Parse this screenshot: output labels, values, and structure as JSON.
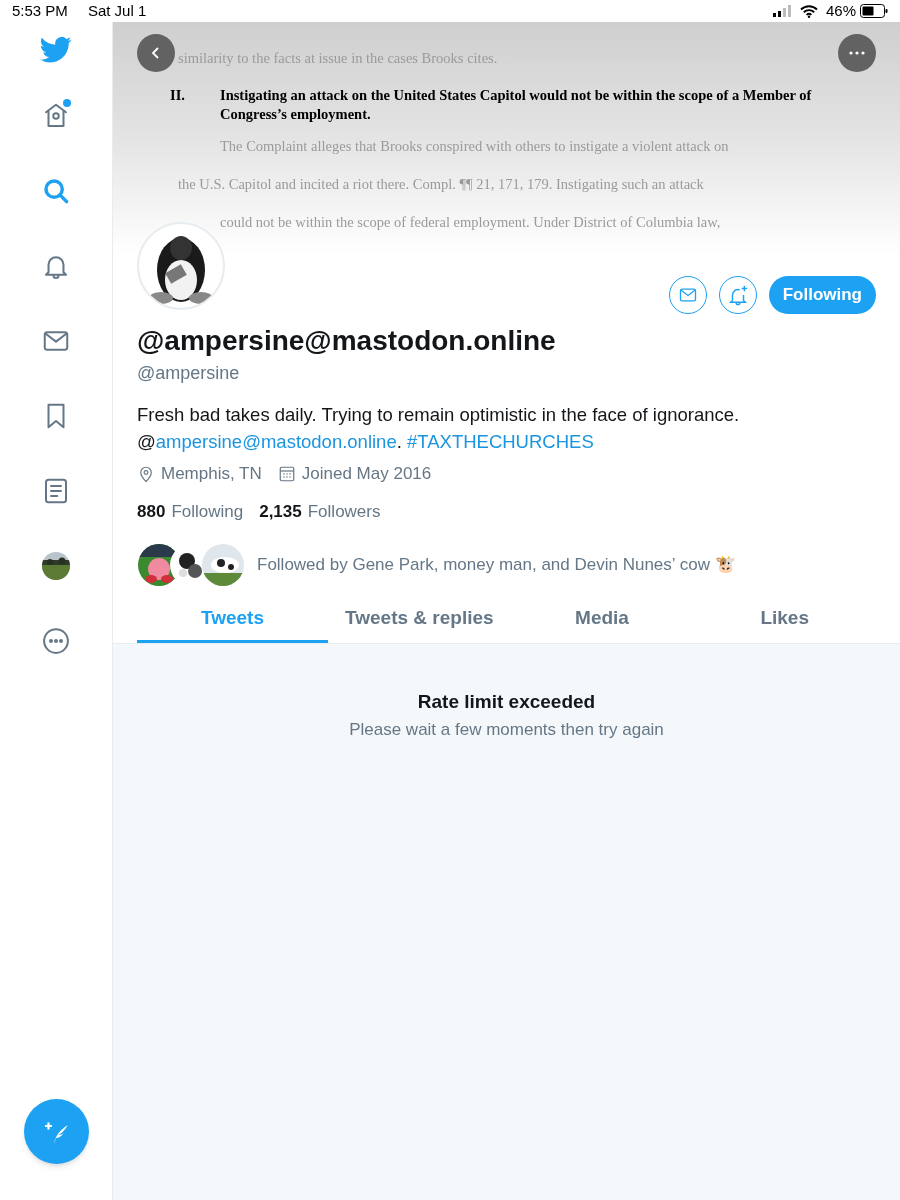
{
  "status_bar": {
    "time": "5:53 PM",
    "date": "Sat Jul 1",
    "battery": "46%"
  },
  "sidebar": {
    "logo": {
      "kind": "logo"
    },
    "items": [
      {
        "kind": "home",
        "selected": false,
        "badge": true
      },
      {
        "kind": "search",
        "selected": true
      },
      {
        "kind": "notifications",
        "selected": false
      },
      {
        "kind": "messages",
        "selected": false
      },
      {
        "kind": "bookmarks",
        "selected": false
      },
      {
        "kind": "lists",
        "selected": false
      },
      {
        "kind": "profile",
        "selected": false
      },
      {
        "kind": "more",
        "selected": false
      }
    ]
  },
  "banner": {
    "document": [
      {
        "kind": "body",
        "text": "similarity to the facts at issue in the cases Brooks cites."
      },
      {
        "kind": "heading",
        "number": "II.",
        "text": "Instigating an attack on the United States Capitol would not be within the scope of a Member of Congress’s employment."
      },
      {
        "kind": "indent",
        "text": "The Complaint alleges that Brooks conspired with others to instigate a violent attack on"
      },
      {
        "kind": "body",
        "text": "the U.S. Capitol and incited a riot there.  Compl. ¶¶ 21, 171, 179.  Instigating such an attack"
      },
      {
        "kind": "indent",
        "text": "could not be within the scope of federal employment.  Under District of Columbia law,"
      }
    ]
  },
  "profile": {
    "display_name": "@ampersine@mastodon.online",
    "handle": "@ampersine",
    "bio": {
      "text": "Fresh bad takes daily. Trying to remain optimistic in the face of ignorance.",
      "at": "@",
      "mention": "ampersine@mastodon.online",
      "punct": ".",
      "hashtag": "#TAXTHECHURCHES"
    },
    "location": "Memphis, TN",
    "joined": "Joined May 2016",
    "stats": [
      {
        "count": "880",
        "label": "Following"
      },
      {
        "count": "2,135",
        "label": "Followers"
      }
    ],
    "followed_by": "Followed by Gene Park, money man, and Devin Nunes’ cow 🐮",
    "follow_button": "Following"
  },
  "tabs": [
    {
      "label": "Tweets",
      "selected": true
    },
    {
      "label": "Tweets & replies",
      "selected": false
    },
    {
      "label": "Media",
      "selected": false
    },
    {
      "label": "Likes",
      "selected": false
    }
  ],
  "empty_state": {
    "title": "Rate limit exceeded",
    "message": "Please wait a few moments then try again"
  }
}
